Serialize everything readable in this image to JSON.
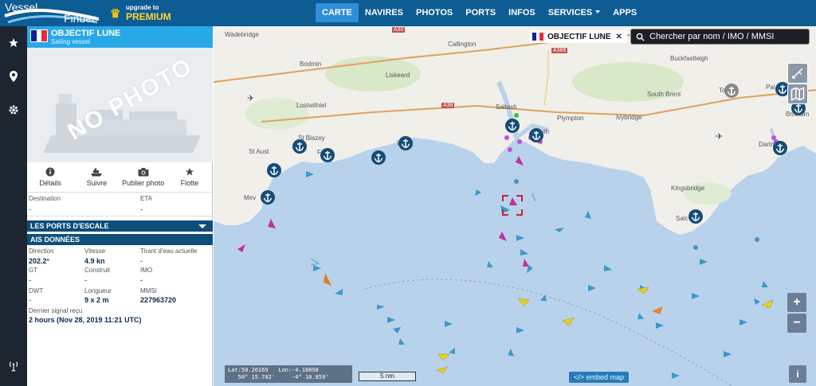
{
  "brand": {
    "line1": "Vessel",
    "line2": "Finder"
  },
  "upgrade": {
    "top": "upgrade to",
    "label": "PREMIUM"
  },
  "nav": {
    "items": [
      "CARTE",
      "NAVIRES",
      "PHOTOS",
      "PORTS",
      "INFOS",
      "SERVICES",
      "APPS"
    ],
    "active": "CARTE"
  },
  "vessel": {
    "name": "OBJECTIF LUNE",
    "type": "Sailing vessel",
    "flag_colors": [
      "#002395",
      "#ffffff",
      "#ed2939"
    ],
    "no_photo": "NO PHOTO"
  },
  "actions": [
    {
      "label": "Détails",
      "icon": "info-icon"
    },
    {
      "label": "Suivre",
      "icon": "ship-icon"
    },
    {
      "label": "Publier photo",
      "icon": "camera-icon"
    },
    {
      "label": "Flotte",
      "icon": "star-icon"
    }
  ],
  "voyage": {
    "destination_label": "Destination",
    "destination_value": "-",
    "eta_label": "ETA",
    "eta_value": "-"
  },
  "sections": {
    "ports": "LES PORTS D'ESCALE",
    "ais": "AIS DONNÉES"
  },
  "ais": {
    "direction_label": "Direction",
    "direction_value": "202.2°",
    "speed_label": "Vitesse",
    "speed_value": "4.9 kn",
    "draught_label": "Tirant d'eau actuelle",
    "draught_value": "-",
    "gt_label": "GT",
    "gt_value": "-",
    "built_label": "Construit",
    "built_value": "-",
    "imo_label": "IMO",
    "imo_value": "-",
    "dwt_label": "DWT",
    "dwt_value": "-",
    "length_label": "Longueur",
    "length_value": "9 x 2 m",
    "mmsi_label": "MMSI",
    "mmsi_value": "227963720",
    "last_signal_label": "Dernier signal reçu",
    "last_signal_value": "2 hours (Nov 28, 2019 11:21 UTC)"
  },
  "map": {
    "tag": "OBJECTIF LUNE",
    "search_placeholder": "Chercher par nom / IMO / MMSI",
    "places": {
      "wadebridge": "Wadebridge",
      "bodmin": "Bodmin",
      "callington": "Callington",
      "liskeard": "Liskeard",
      "buckfastleigh": "Buckfastleigh",
      "lostwithiel": "Lostwithiel",
      "saltash": "Saltash",
      "plympton": "Plympton",
      "ivybridge": "Ivybridge",
      "south_brent": "South Brent",
      "st_blazey": "St Blazey",
      "st_austell": "St Aust",
      "fowey": "F",
      "looe": "L",
      "mevagissey": "Mev",
      "plymouth": "uth",
      "kingsbridge": "Kingsbridge",
      "salcombe": "Salc",
      "dartmouth": "Dartm",
      "totnes": "To",
      "paignton": "Pai",
      "brixham": "Brixham"
    },
    "roads": {
      "a30": "A30",
      "a386": "A386",
      "a38": "A38"
    },
    "coords": {
      "lat": "Lat:50.26169",
      "lon": "Lon:-4.18098",
      "lat_dms": "50° 15.702'",
      "lon_dms": "-4° 10.859'"
    },
    "scale": "5 nm",
    "embed": "</> embed map",
    "info": "i",
    "zoom_in": "+",
    "zoom_out": "−"
  }
}
